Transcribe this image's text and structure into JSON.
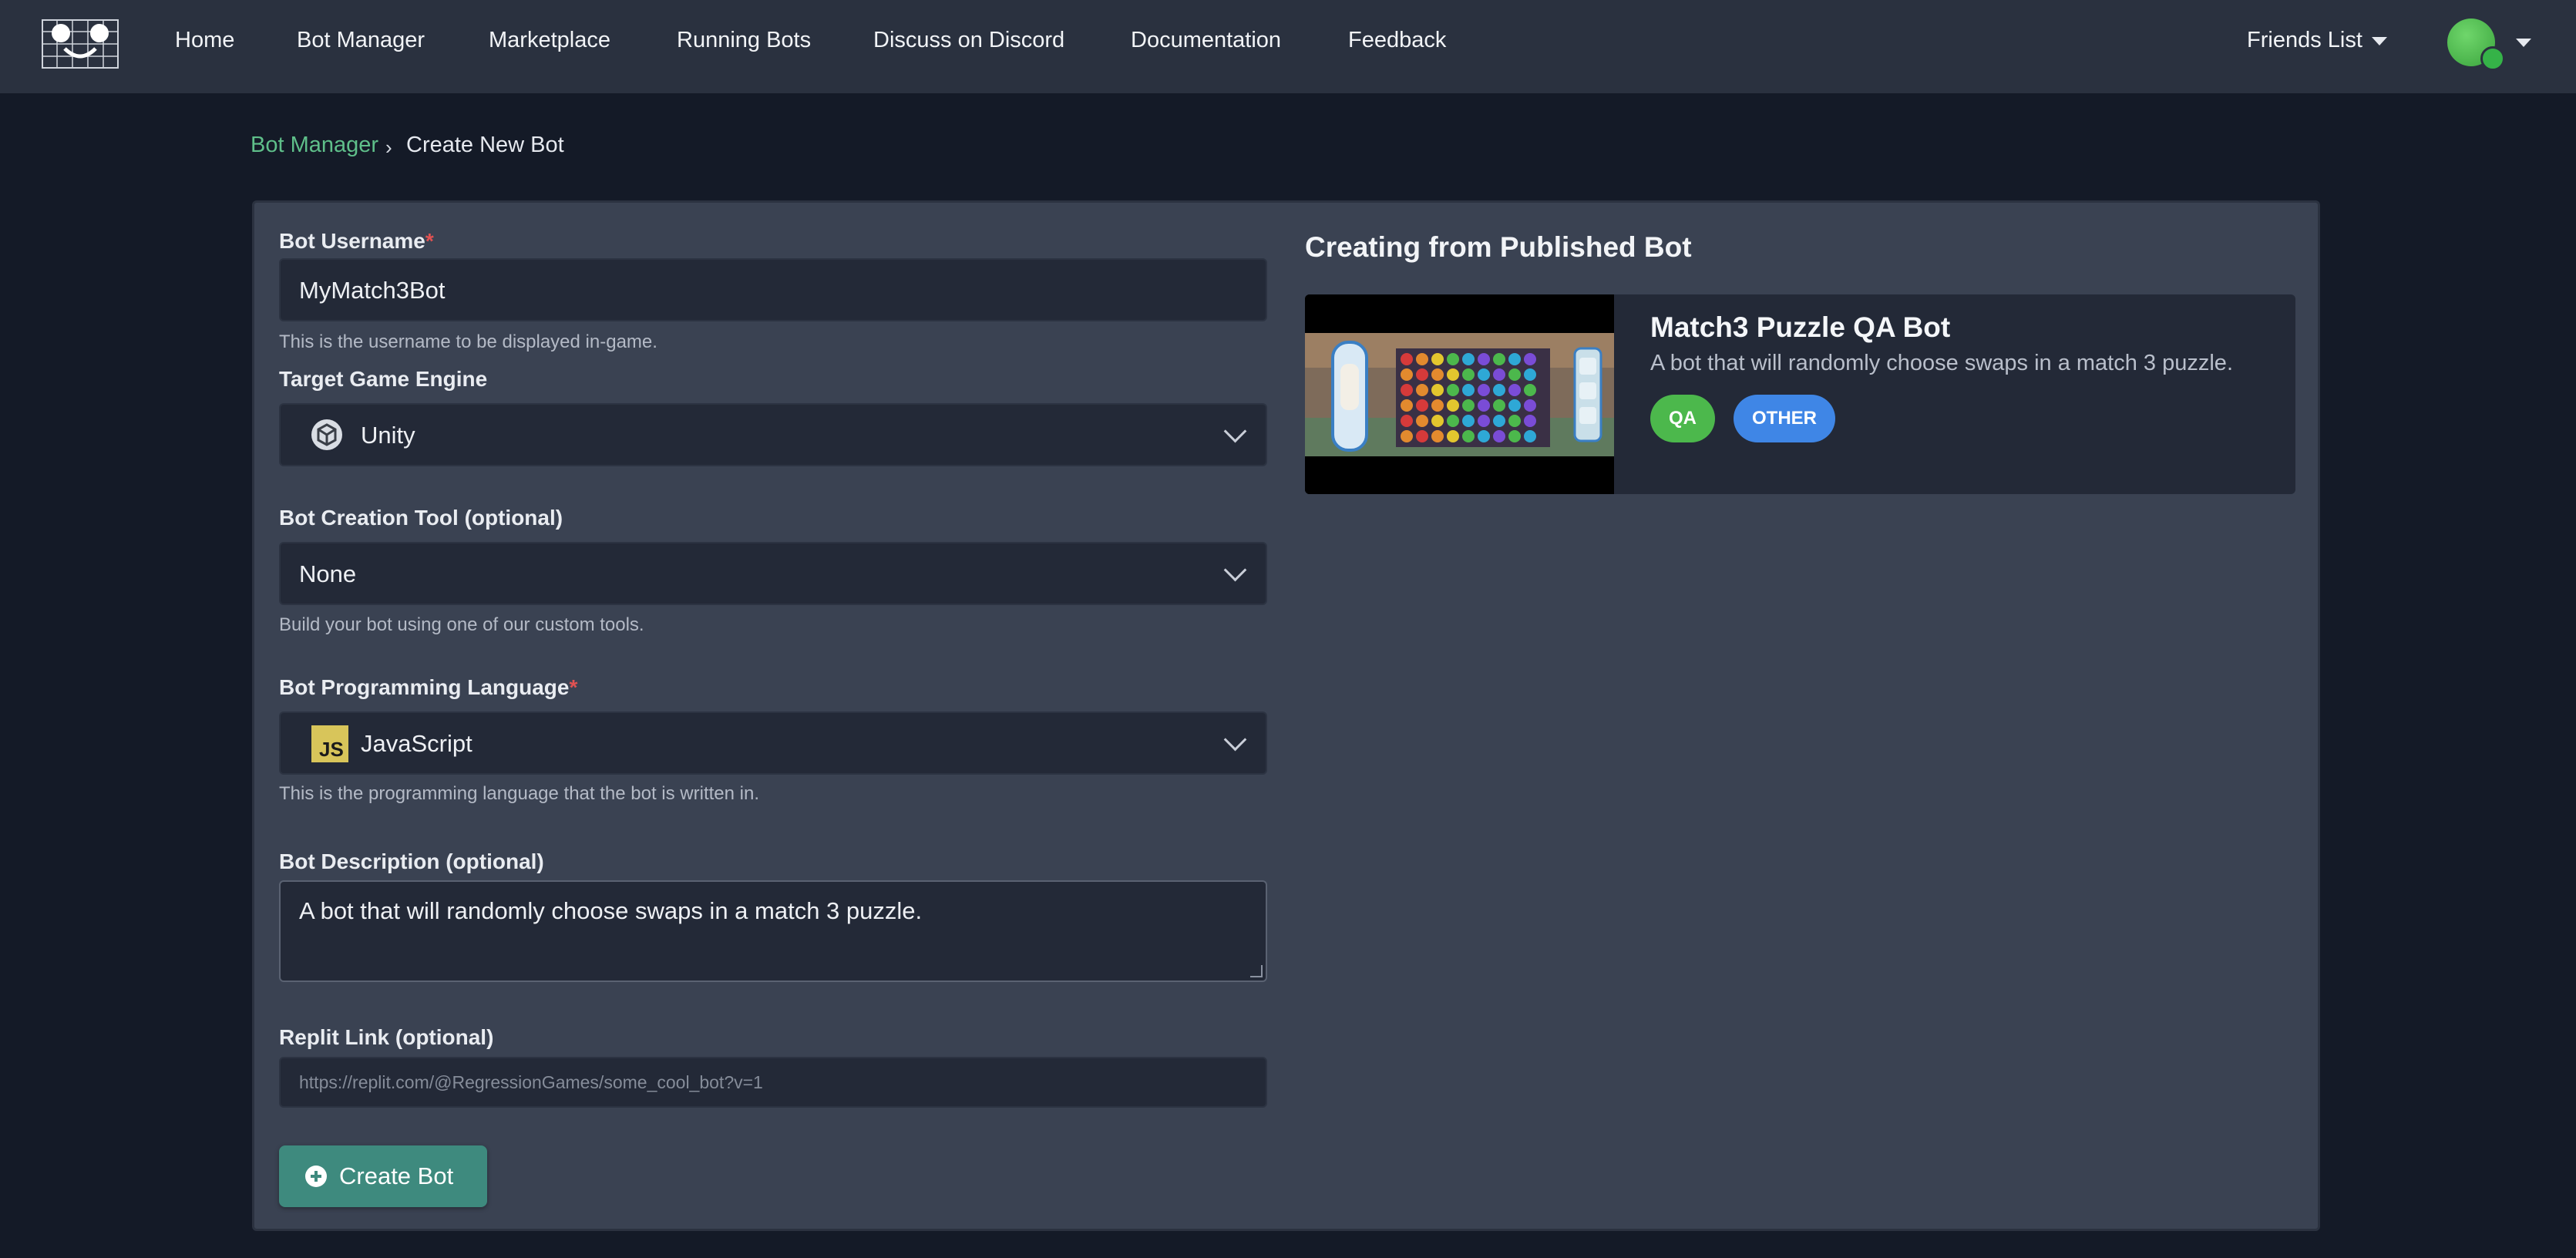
{
  "nav": {
    "links": [
      "Home",
      "Bot Manager",
      "Marketplace",
      "Running Bots",
      "Discuss on Discord",
      "Documentation",
      "Feedback"
    ],
    "friends_label": "Friends List"
  },
  "breadcrumb": {
    "parent": "Bot Manager",
    "separator": "›",
    "current": "Create New Bot"
  },
  "form": {
    "username": {
      "label": "Bot Username",
      "required_mark": "*",
      "value": "MyMatch3Bot",
      "help": "This is the username to be displayed in-game."
    },
    "engine": {
      "label": "Target Game Engine",
      "value": "Unity",
      "icon": "unity-icon"
    },
    "tool": {
      "label": "Bot Creation Tool (optional)",
      "value": "None",
      "help": "Build your bot using one of our custom tools."
    },
    "language": {
      "label": "Bot Programming Language",
      "required_mark": "*",
      "value": "JavaScript",
      "icon_text": "JS",
      "help": "This is the programming language that the bot is written in."
    },
    "description": {
      "label": "Bot Description (optional)",
      "value": "A bot that will randomly choose swaps in a match 3 puzzle."
    },
    "replit": {
      "label": "Replit Link (optional)",
      "placeholder": "https://replit.com/@RegressionGames/some_cool_bot?v=1"
    },
    "submit_label": "Create Bot"
  },
  "published": {
    "heading": "Creating from Published Bot",
    "bot_name": "Match3 Puzzle QA Bot",
    "bot_description": "A bot that will randomly choose swaps in a match 3 puzzle.",
    "tags": [
      "QA",
      "OTHER"
    ]
  },
  "colors": {
    "accent_button": "#3e8a7e",
    "link": "#5fbf8a",
    "tag_qa": "#4cb84c",
    "tag_other": "#3f86e6",
    "required": "#e05252"
  }
}
